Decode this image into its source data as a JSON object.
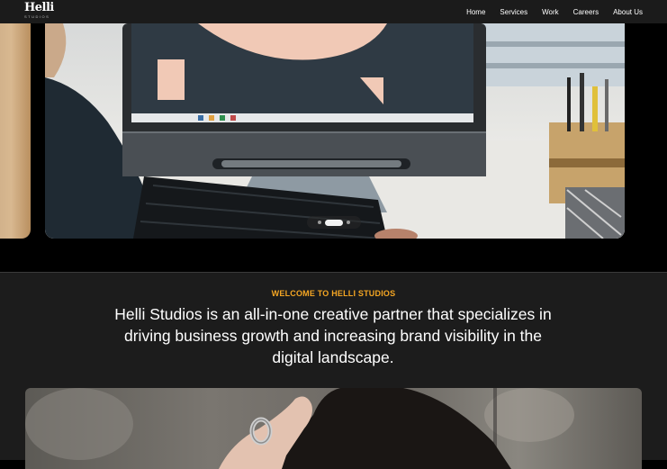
{
  "brand": {
    "logo": "Helli",
    "tagline": "STUDIOS"
  },
  "nav": {
    "links": [
      {
        "label": "Home"
      },
      {
        "label": "Services"
      },
      {
        "label": "Work"
      },
      {
        "label": "Careers"
      },
      {
        "label": "About Us"
      }
    ]
  },
  "carousel": {
    "slide_count": 3,
    "active_index": 1
  },
  "welcome": {
    "eyebrow": "WELCOME TO HELLI STUDIOS",
    "lead": "Helli Studios is an all-in-one creative partner that specializes in driving business growth and increasing brand visibility in the digital landscape."
  },
  "colors": {
    "accent": "#f5a623",
    "nav_bg": "#1b1b1b",
    "section_bg": "#1c1c1c"
  }
}
